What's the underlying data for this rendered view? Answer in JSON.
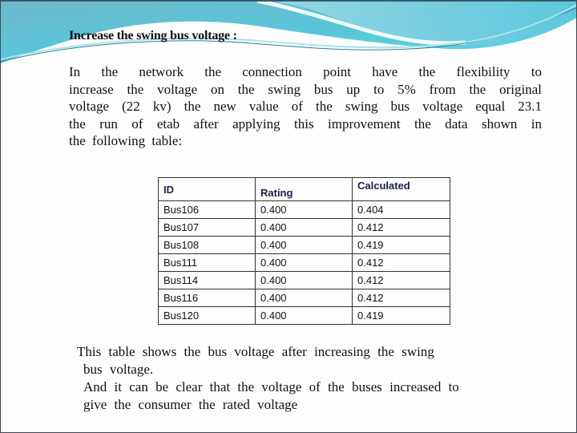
{
  "slide": {
    "title": "Increase the swing bus voltage :",
    "intro_lines": [
      "In the network the connection point have the flexibility to",
      "increase the voltage on the swing bus up to 5% from the original",
      "voltage (22 kv) the new value of the swing bus voltage equal 23.1",
      "the run of etab after applying this improvement the data shown in",
      "the following table:"
    ],
    "table": {
      "headers": [
        "ID",
        "Rating",
        "Calculated"
      ],
      "rows": [
        [
          "Bus106",
          "0.400",
          "0.404"
        ],
        [
          "Bus107",
          "0.400",
          "0.412"
        ],
        [
          "Bus108",
          "0.400",
          "0.419"
        ],
        [
          "Bus111",
          "0.400",
          "0.412"
        ],
        [
          "Bus114",
          "0.400",
          "0.412"
        ],
        [
          "Bus116",
          "0.400",
          "0.412"
        ],
        [
          "Bus120",
          "0.400",
          "0.419"
        ]
      ]
    },
    "conclusion_lines": [
      "This table shows the bus voltage after increasing the swing",
      "bus voltage.",
      "And it can be clear that the voltage of the buses increased to",
      "give the consumer the rated voltage"
    ]
  },
  "theme": {
    "wave_light": "#5fd3e0",
    "wave_dark": "#3a8aa8",
    "border": "#3f4a52"
  }
}
